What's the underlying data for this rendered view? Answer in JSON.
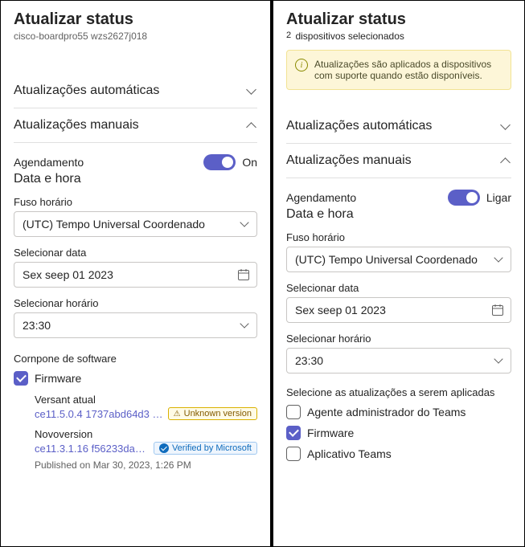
{
  "left": {
    "title": "Atualizar status",
    "device": "cisco-boardpro55 wzs2627j018",
    "accordion_auto": "Atualizações automáticas",
    "accordion_manual": "Atualizações manuais",
    "schedule_label": "Agendamento",
    "schedule_toggle": "On",
    "datetime_heading": "Data e hora",
    "timezone_label": "Fuso horário",
    "timezone_value": "(UTC) Tempo Universal Coordenado",
    "date_label": "Selecionar data",
    "date_value": "Sex seep 01 2023",
    "time_label": "Selecionar horário",
    "time_value": "23:30",
    "component_label": "Cornpone de software",
    "firmware_label": "Firmware",
    "current_label": "Versant atual",
    "current_value": "ce11.5.0.4 1737abd64d3 2023...",
    "unknown_badge": "Unknown version",
    "new_label": "Novoversion",
    "new_value": "ce11.3.1.16 f56233da7d5 2...",
    "verified_badge": "Verified by Microsoft",
    "published": "Published on Mar 30, 2023, 1:26 PM"
  },
  "right": {
    "title": "Atualizar status",
    "count": "2",
    "count_text": "dispositivos selecionados",
    "banner": "Atualizações são aplicados a dispositivos com suporte quando estão disponíveis.",
    "accordion_auto": "Atualizações automáticas",
    "accordion_manual": "Atualizações manuais",
    "schedule_label": "Agendamento",
    "schedule_toggle": "Ligar",
    "datetime_heading": "Data e hora",
    "timezone_label": "Fuso horário",
    "timezone_value": "(UTC) Tempo Universal Coordenado",
    "date_label": "Selecionar data",
    "date_value": "Sex seep 01 2023",
    "time_label": "Selecionar horário",
    "time_value": "23:30",
    "select_updates_label": "Selecione as atualizações a serem aplicadas",
    "opt_agent": "Agente administrador do Teams",
    "opt_firmware": "Firmware",
    "opt_app": "Aplicativo Teams"
  }
}
